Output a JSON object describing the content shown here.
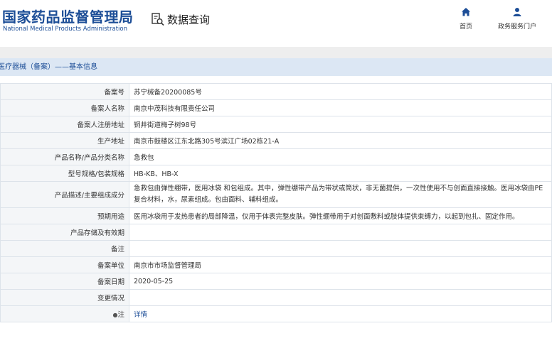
{
  "header": {
    "logo_cn": "国家药品监督管理局",
    "logo_en": "National Medical Products Administration",
    "page_title": "数据查询",
    "nav": [
      {
        "label": "首页",
        "icon": "home-icon"
      },
      {
        "label": "政务服务门户",
        "icon": "user-icon"
      }
    ]
  },
  "breadcrumb": "医疗器械（备案）——基本信息",
  "rows": [
    {
      "label": "备案号",
      "value": "苏宁械备20200085号"
    },
    {
      "label": "备案人名称",
      "value": "南京中茂科技有限责任公司"
    },
    {
      "label": "备案人注册地址",
      "value": "铜井街道梅子树98号"
    },
    {
      "label": "生产地址",
      "value": "南京市鼓楼区江东北路305号滨江广场02栋21-A"
    },
    {
      "label": "产品名称/产品分类名称",
      "value": "急救包"
    },
    {
      "label": "型号规格/包装规格",
      "value": "HB-KB、HB-X"
    },
    {
      "label": "产品描述/主要组成成分",
      "value": "急救包由弹性绷带，医用冰袋 和包组成。其中，弹性绷带产品为带状或筒状，非无菌提供，一次性使用不与创面直接接触。医用冰袋由PE复合材料，水，尿素组成。包由面料、辅料组成。"
    },
    {
      "label": "预期用途",
      "value": "医用冰袋用于发热患者的局部降温，仅用于体表完整皮肤。弹性绷带用于对创面敷料或肢体提供束缚力，以起到包扎、固定作用。"
    },
    {
      "label": "产品存储及有效期",
      "value": ""
    },
    {
      "label": "备注",
      "value": ""
    },
    {
      "label": "备案单位",
      "value": "南京市市场监督管理局"
    },
    {
      "label": "备案日期",
      "value": "2020-05-25"
    },
    {
      "label": "变更情况",
      "value": ""
    },
    {
      "label": "注",
      "value": "详情"
    }
  ],
  "colors": {
    "brand": "#1d4e97",
    "breadcrumb_bg": "#dce7f4",
    "label_bg": "#f4f6f8"
  }
}
